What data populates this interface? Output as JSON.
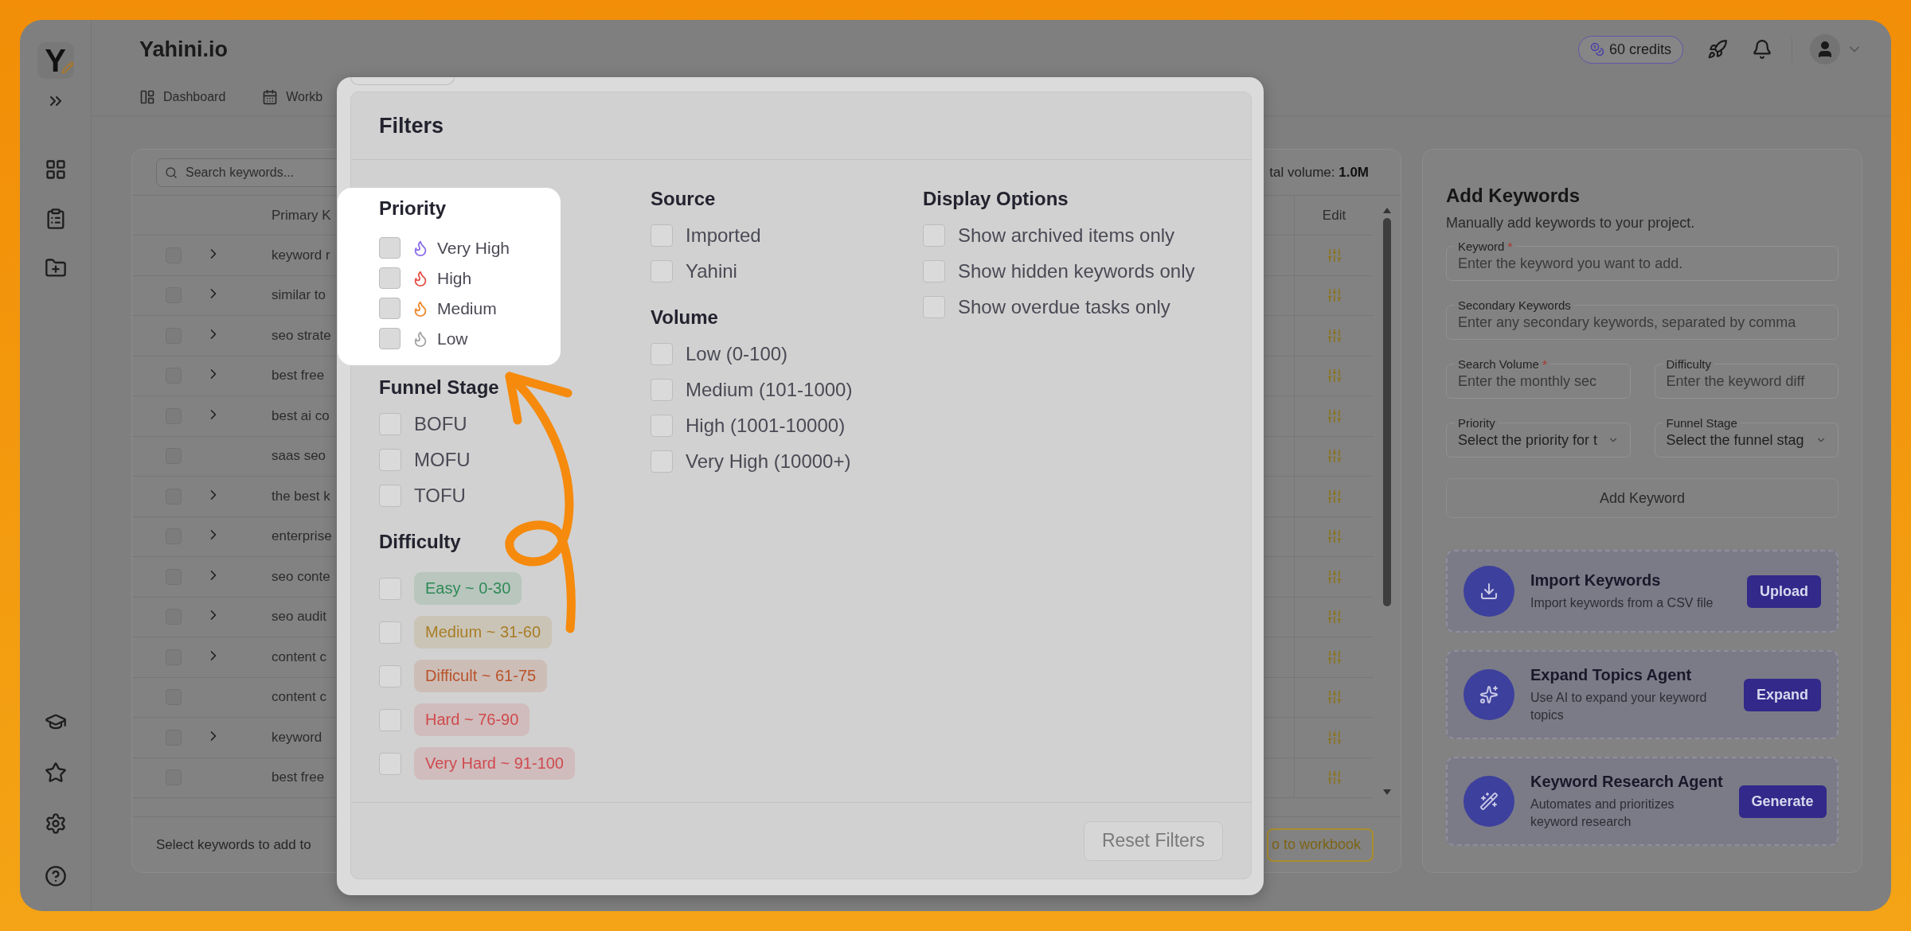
{
  "sidebar": {
    "logo": "Y"
  },
  "header": {
    "title": "Yahini.io",
    "tabs": [
      {
        "label": "Dashboard",
        "kind": "dashboard"
      },
      {
        "label": "Workb",
        "kind": "calendar"
      }
    ],
    "credits": "60 credits"
  },
  "table": {
    "search": {
      "placeholder": "Search keywords..."
    },
    "total_volume": "tal volume: **1.0M**",
    "columns": [
      "Primary K",
      "Edit"
    ],
    "rows": [
      {
        "keyword": "keyword r",
        "expandable": true,
        "checked": false
      },
      {
        "keyword": "similar to",
        "expandable": true,
        "checked": false
      },
      {
        "keyword": "seo strate",
        "expandable": true,
        "checked": false
      },
      {
        "keyword": "best free",
        "expandable": true,
        "checked": false
      },
      {
        "keyword": "best ai co",
        "expandable": true,
        "checked": false
      },
      {
        "keyword": "saas seo",
        "expandable": false,
        "checked": false
      },
      {
        "keyword": "the best k",
        "expandable": true,
        "checked": false
      },
      {
        "keyword": "enterprise",
        "expandable": true,
        "checked": false
      },
      {
        "keyword": "seo conte",
        "expandable": true,
        "checked": false
      },
      {
        "keyword": "seo audit",
        "expandable": true,
        "checked": false
      },
      {
        "keyword": "content c",
        "expandable": true,
        "checked": false
      },
      {
        "keyword": "content c",
        "expandable": false,
        "checked": false
      },
      {
        "keyword": "keyword",
        "expandable": true,
        "checked": false
      },
      {
        "keyword": "best free",
        "expandable": false,
        "checked": false
      }
    ],
    "footer_text": "Select keywords to add to",
    "footer_button": "o to workbook"
  },
  "filters": {
    "title": "Filters",
    "columns": [
      [
        {
          "title": "Priority",
          "highlighted": true,
          "items": [
            {
              "label": "Very High",
              "kind": "priority",
              "color": "#8b6fe8",
              "checked": false
            },
            {
              "label": "High",
              "kind": "priority",
              "color": "#e5534b",
              "checked": false
            },
            {
              "label": "Medium",
              "kind": "priority",
              "color": "#ef8a2d",
              "checked": false
            },
            {
              "label": "Low",
              "kind": "priority",
              "color": "#a5a5a5",
              "checked": false
            }
          ]
        },
        {
          "title": "Funnel Stage",
          "highlighted": false,
          "items": [
            {
              "label": "BOFU",
              "kind": "plain",
              "checked": false
            },
            {
              "label": "MOFU",
              "kind": "plain",
              "checked": false
            },
            {
              "label": "TOFU",
              "kind": "plain",
              "checked": false
            }
          ]
        },
        {
          "title": "Difficulty",
          "highlighted": false,
          "items": [
            {
              "label": "Easy ~ 0-30",
              "kind": "badge",
              "color": "#2f8a55",
              "checked": false
            },
            {
              "label": "Medium ~ 31-60",
              "kind": "badge",
              "color": "#a87d25",
              "checked": false
            },
            {
              "label": "Difficult ~ 61-75",
              "kind": "badge",
              "color": "#b9532a",
              "checked": false
            },
            {
              "label": "Hard ~ 76-90",
              "kind": "badge",
              "color": "#d0494c",
              "checked": false
            },
            {
              "label": "Very Hard ~ 91-100",
              "kind": "badge",
              "color": "#cf4a4f",
              "checked": false
            }
          ]
        }
      ],
      [
        {
          "title": "Source",
          "highlighted": false,
          "items": [
            {
              "label": "Imported",
              "kind": "plain",
              "checked": false
            },
            {
              "label": "Yahini",
              "kind": "plain",
              "checked": false
            }
          ]
        },
        {
          "title": "Volume",
          "highlighted": false,
          "items": [
            {
              "label": "Low (0-100)",
              "kind": "plain",
              "checked": false
            },
            {
              "label": "Medium (101-1000)",
              "kind": "plain",
              "checked": false
            },
            {
              "label": "High (1001-10000)",
              "kind": "plain",
              "checked": false
            },
            {
              "label": "Very High (10000+)",
              "kind": "plain",
              "checked": false
            }
          ]
        }
      ],
      [
        {
          "title": "Display Options",
          "highlighted": false,
          "items": [
            {
              "label": "Show archived items only",
              "kind": "plain",
              "checked": false
            },
            {
              "label": "Show hidden keywords only",
              "kind": "plain",
              "checked": false
            },
            {
              "label": "Show overdue tasks only",
              "kind": "plain",
              "checked": false
            }
          ]
        }
      ]
    ],
    "reset_button": "Reset Filters"
  },
  "add_keywords": {
    "title": "Add Keywords",
    "subtitle": "Manually add keywords to your project.",
    "keyword": {
      "label": "Keyword",
      "required_mark": "*",
      "placeholder": "Enter the keyword you want to add."
    },
    "secondary": {
      "label": "Secondary Keywords",
      "placeholder": "Enter any secondary keywords, separated by comma"
    },
    "search_volume": {
      "label": "Search Volume",
      "required_mark": "*",
      "placeholder": "Enter the monthly sec"
    },
    "difficulty": {
      "label": "Difficulty",
      "placeholder": "Enter the keyword diff"
    },
    "priority": {
      "label": "Priority",
      "placeholder": "Select the priority for t"
    },
    "funnel_stage": {
      "label": "Funnel Stage",
      "placeholder": "Select the funnel stag"
    },
    "add_button": "Add Keyword",
    "actions": [
      {
        "kind": "import",
        "title": "Import Keywords",
        "description": "Import keywords from a CSV file",
        "button": "Upload"
      },
      {
        "kind": "expand",
        "title": "Expand Topics Agent",
        "description": "Use AI to expand your keyword topics",
        "button": "Expand"
      },
      {
        "kind": "research",
        "title": "Keyword Research Agent",
        "description": "Automates and prioritizes keyword research",
        "button": "Generate"
      }
    ]
  }
}
